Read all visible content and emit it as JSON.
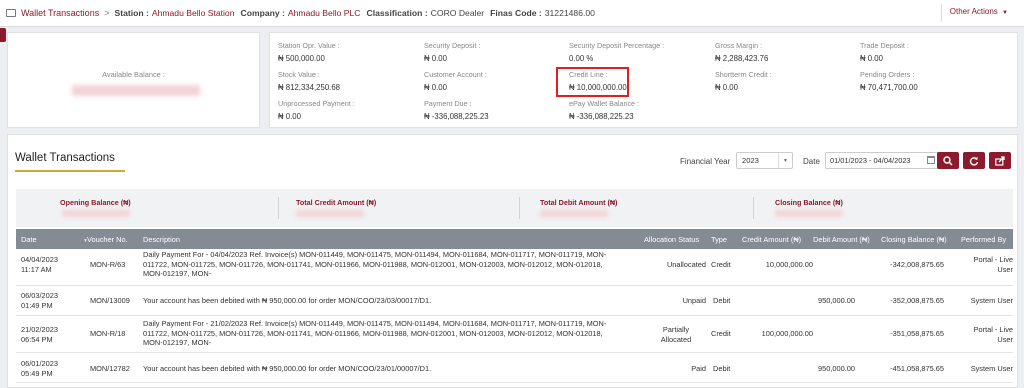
{
  "header": {
    "breadcrumb_link": "Wallet Transactions",
    "breadcrumb_sep": ">",
    "station_key": "Station :",
    "station_value": "Ahmadu Bello Station",
    "company_key": "Company :",
    "company_value": "Ahmadu Bello PLC",
    "classification_key": "Classification :",
    "classification_value": "CORO Dealer",
    "finas_key": "Finas Code :",
    "finas_value": "31221486.00",
    "other_actions": "Other Actions",
    "other_actions_caret": "▼"
  },
  "available_balance": {
    "label": "Available Balance :"
  },
  "stats": [
    {
      "label": "Station Opr. Value :",
      "value": "₦ 500,000.00"
    },
    {
      "label": "Security Deposit :",
      "value": "₦ 0.00"
    },
    {
      "label": "Security Deposit Percentage :",
      "value": "0.00 %"
    },
    {
      "label": "Gross Margin :",
      "value": "₦ 2,288,423.76"
    },
    {
      "label": "Trade Deposit :",
      "value": "₦ 0.00"
    },
    {
      "label": "Stock Value :",
      "value": "₦ 812,334,250.68"
    },
    {
      "label": "Customer Account :",
      "value": "₦ 0.00"
    },
    {
      "label": "Credit Line :",
      "value": "₦ 10,000,000.00"
    },
    {
      "label": "Shortterm Credit :",
      "value": "₦ 0.00"
    },
    {
      "label": "Pending Orders :",
      "value": "₦ 70,471,700.00"
    },
    {
      "label": "Unprocessed Payment :",
      "value": "₦ 0.00"
    },
    {
      "label": "Payment Due :",
      "value": "₦ -336,088,225.23"
    },
    {
      "label": "ePay Wallet Balance :",
      "value": "₦ -336,088,225.23"
    }
  ],
  "wallet": {
    "title": "Wallet Transactions",
    "financial_year_label": "Financial Year",
    "financial_year_value": "2023",
    "date_label": "Date",
    "date_value": "01/01/2023 - 04/04/2023",
    "summary": {
      "opening": "Opening Balance (₦)",
      "credit": "Total Credit Amount (₦)",
      "debit": "Total Debit Amount (₦)",
      "closing": "Closing Balance (₦)"
    },
    "columns": [
      "Date",
      "Voucher No.",
      "Description",
      "Allocation Status",
      "Type",
      "Credit Amount (₦)",
      "Debit Amount (₦)",
      "Closing Balance (₦)",
      "Performed By"
    ],
    "rows": [
      {
        "date": "04/04/2023",
        "time": "11:17 AM",
        "voucher": "MON-R/63",
        "desc": [
          "Daily Payment For - 04/04/2023 Ref. Invoice(s) MON-011449, MON-011475, MON-011494, MON-011684, MON-011717, MON-011719, MON-",
          "011722, MON-011725, MON-011726, MON-011741, MON-011966, MON-011988, MON-012001, MON-012003, MON-012012, MON-012018,",
          "MON-012197, MON-"
        ],
        "status": [
          "Unallocated"
        ],
        "type": "Credit",
        "credit": "10,000,000.00",
        "debit": "",
        "closing": "-342,008,875.65",
        "by": [
          "Portal - Live",
          "User"
        ]
      },
      {
        "date": "06/03/2023",
        "time": "01:49 PM",
        "voucher": "MON/13009",
        "desc": [
          "Your account has been debited with ₦ 950,000.00 for order MON/COO/23/03/00017/D1."
        ],
        "status": [
          "Unpaid"
        ],
        "type": "Debit",
        "credit": "",
        "debit": "950,000.00",
        "closing": "-352,008,875.65",
        "by": [
          "System User"
        ]
      },
      {
        "date": "21/02/2023",
        "time": "06:54 PM",
        "voucher": "MON-R/18",
        "desc": [
          "Daily Payment For - 21/02/2023 Ref. Invoice(s) MON-011449, MON-011475, MON-011494, MON-011684, MON-011717, MON-011719, MON-",
          "011722, MON-011725, MON-011726, MON-011741, MON-011966, MON-011988, MON-012001, MON-012003, MON-012012, MON-012018,",
          "MON-012197, MON-"
        ],
        "status": [
          "Partially",
          "Allocated"
        ],
        "type": "Credit",
        "credit": "100,000,000.00",
        "debit": "",
        "closing": "-351,058,875.65",
        "by": [
          "Portal - Live",
          "User"
        ]
      },
      {
        "date": "06/01/2023",
        "time": "05:49 PM",
        "voucher": "MON/12782",
        "desc": [
          "Your account has been debited with ₦ 950,000.00 for order MON/COO/23/01/00007/D1."
        ],
        "status": [
          "Paid"
        ],
        "type": "Debit",
        "credit": "",
        "debit": "950,000.00",
        "closing": "-451,058,875.65",
        "by": [
          "System User"
        ]
      }
    ]
  },
  "colors": {
    "brand": "#8b1a2e",
    "accent": "#d4a832",
    "highlight_box": "#e02020",
    "table_header": "#858b94"
  }
}
